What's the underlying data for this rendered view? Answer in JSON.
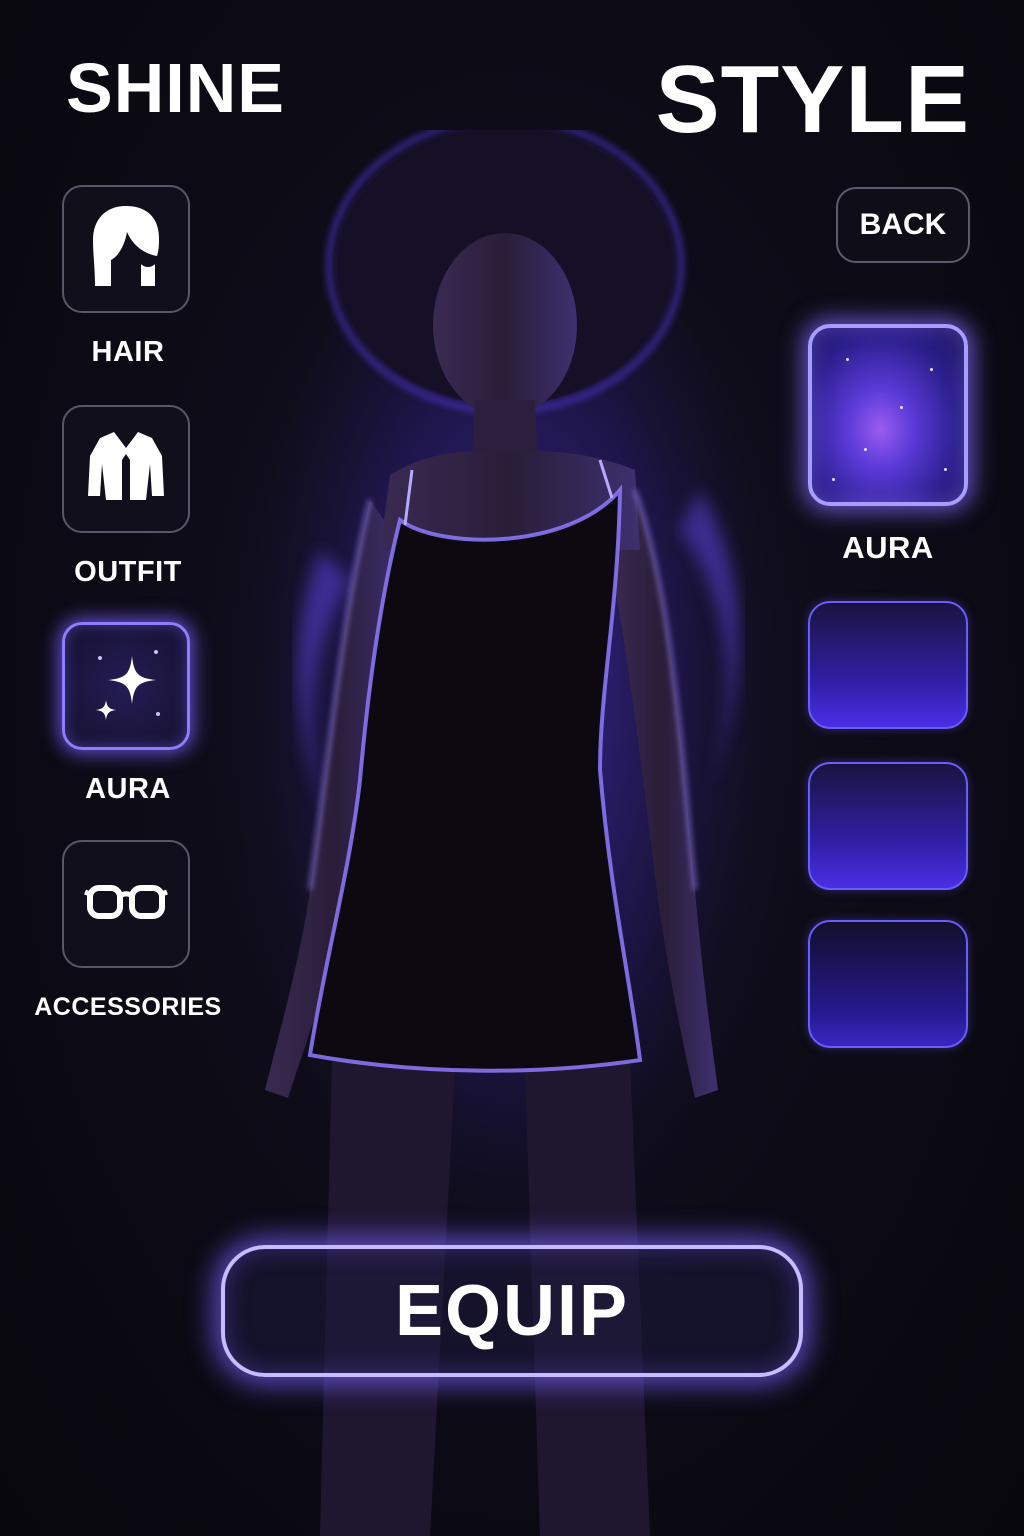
{
  "header": {
    "title_left": "SHINE",
    "title_right": "STYLE"
  },
  "categories": [
    {
      "label": "HAIR",
      "icon": "hair-icon",
      "active": false
    },
    {
      "label": "OUTFIT",
      "icon": "jacket-icon",
      "active": false
    },
    {
      "label": "AURA",
      "icon": "sparkle-icon",
      "active": true
    },
    {
      "label": "ACCESSORIES",
      "icon": "glasses-icon",
      "active": false
    }
  ],
  "right_panel": {
    "back_label": "BACK",
    "selected_label": "AURA"
  },
  "equip_label": "EQUIP",
  "colors": {
    "accent": "#8c7dff",
    "glow": "#785fff",
    "background": "#0b0a12",
    "aura_primary": "#5a3ad8"
  }
}
